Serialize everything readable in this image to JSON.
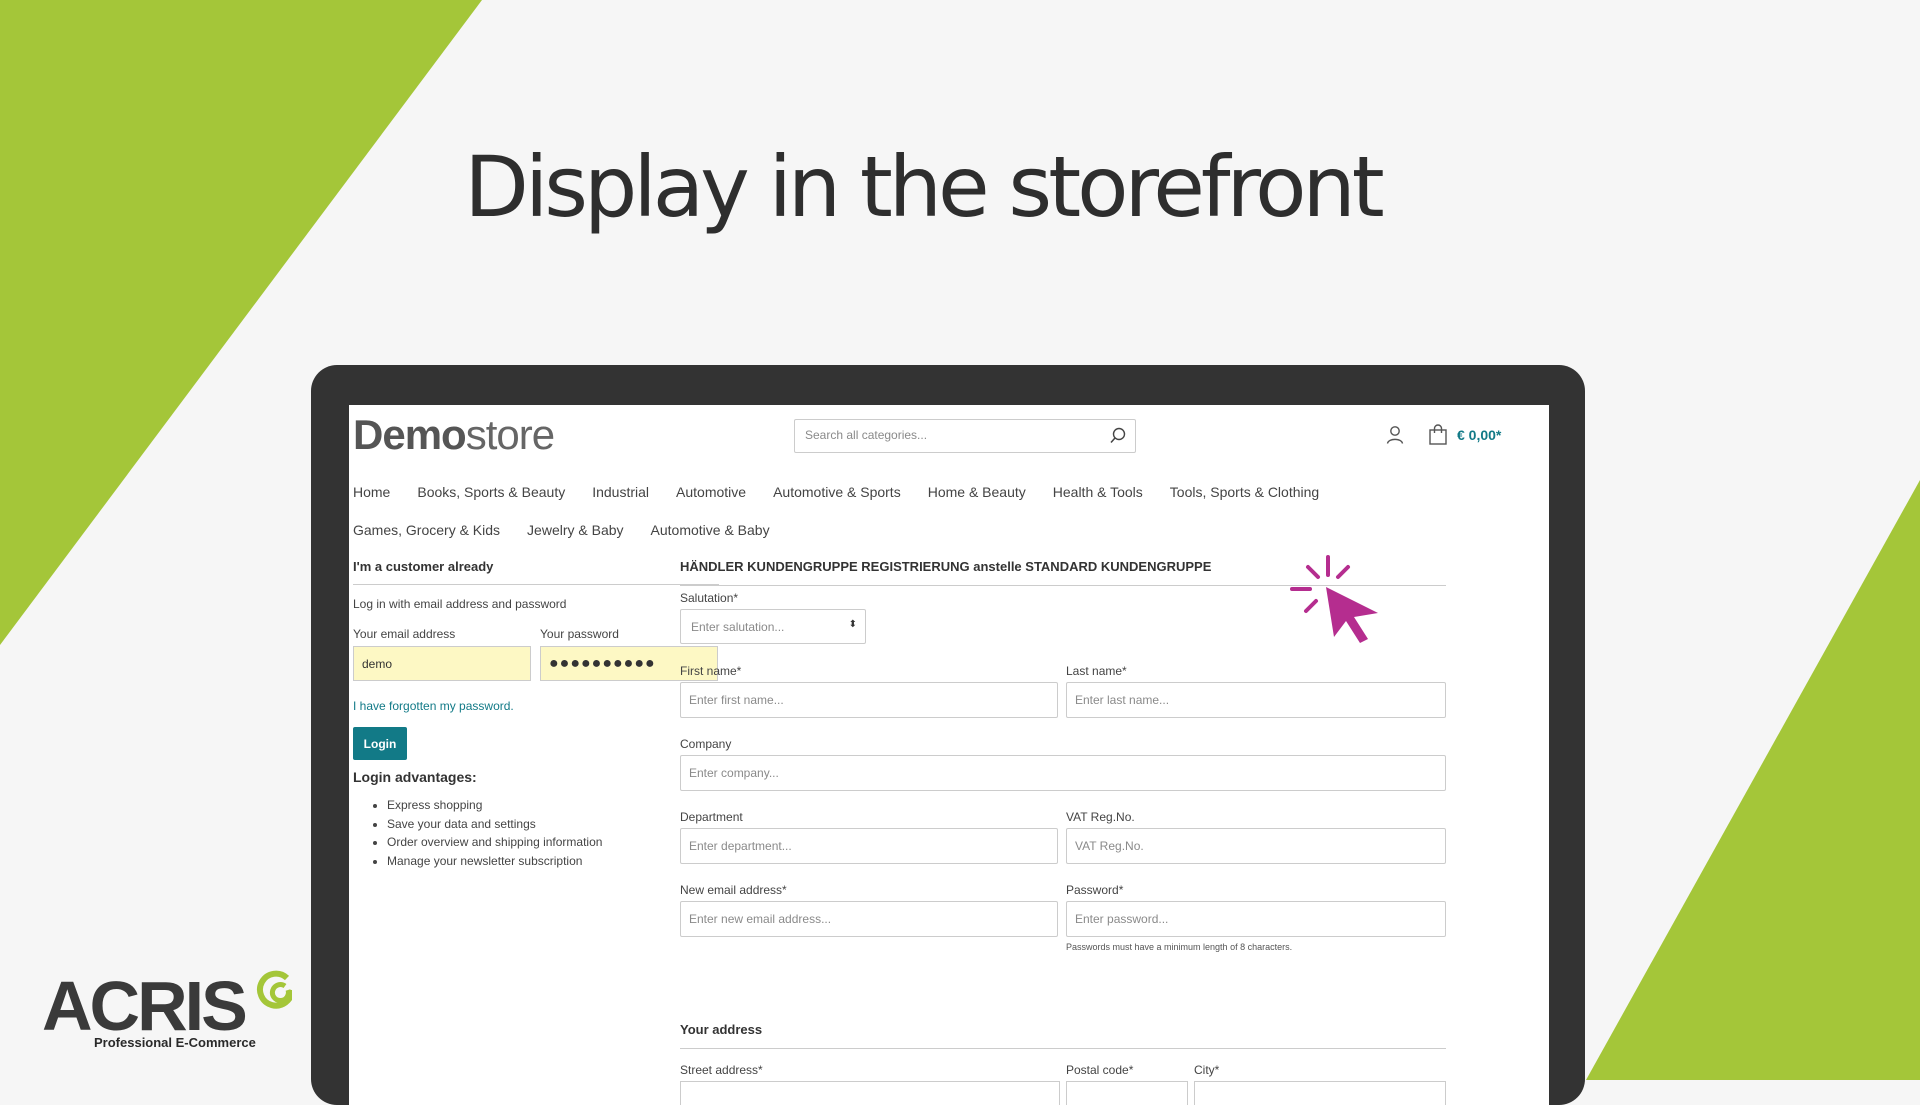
{
  "hero": {
    "title": "Display in the storefront"
  },
  "colors": {
    "accent_green": "#a4c639",
    "teal": "#127a87",
    "pointer_magenta": "#b52d8f",
    "laptop_frame": "#333333"
  },
  "brand": {
    "name": "ACRIS",
    "tagline": "Professional E-Commerce",
    "icon": "acris-logo-icon"
  },
  "store": {
    "logo_bold": "Demo",
    "logo_light": "store",
    "search_placeholder": "Search all categories...",
    "cart_total": "€ 0,00*",
    "nav_row1": [
      "Home",
      "Books, Sports & Beauty",
      "Industrial",
      "Automotive",
      "Automotive & Sports",
      "Home & Beauty",
      "Health & Tools",
      "Tools, Sports & Clothing"
    ],
    "nav_row2": [
      "Games, Grocery & Kids",
      "Jewelry & Baby",
      "Automotive & Baby"
    ]
  },
  "login": {
    "title": "I'm a customer already",
    "intro": "Log in with email address and password",
    "email_label": "Your email address",
    "email_value": "demo",
    "password_label": "Your password",
    "password_value": "●●●●●●●●●●",
    "forgot_link": "I have forgotten my password.",
    "button": "Login",
    "advantages_title": "Login advantages:",
    "advantages": [
      "Express shopping",
      "Save your data and settings",
      "Order overview and shipping information",
      "Manage your newsletter subscription"
    ]
  },
  "register": {
    "title": "HÄNDLER KUNDENGRUPPE REGISTRIERUNG anstelle STANDARD KUNDENGRUPPE",
    "salutation_label": "Salutation*",
    "salutation_placeholder": "Enter salutation...",
    "firstname_label": "First name*",
    "firstname_placeholder": "Enter first name...",
    "lastname_label": "Last name*",
    "lastname_placeholder": "Enter last name...",
    "company_label": "Company",
    "company_placeholder": "Enter company...",
    "department_label": "Department",
    "department_placeholder": "Enter department...",
    "vat_label": "VAT Reg.No.",
    "vat_placeholder": "VAT Reg.No.",
    "email_label": "New email address*",
    "email_placeholder": "Enter new email address...",
    "password_label": "Password*",
    "password_placeholder": "Enter password...",
    "password_hint": "Passwords must have a minimum length of 8 characters.",
    "address_title": "Your address",
    "street_label": "Street address*",
    "postal_label": "Postal code*",
    "city_label": "City*"
  }
}
